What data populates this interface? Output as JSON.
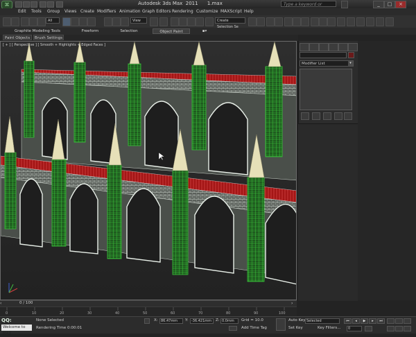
{
  "titlebar": {
    "title": "Autodesk 3ds Max  2011      1.max",
    "search_placeholder": "Type a keyword or phrase",
    "logo_icon": "3dsmax-logo-icon",
    "controls": [
      "_",
      "□",
      "×"
    ]
  },
  "menu": [
    "Edit",
    "Tools",
    "Group",
    "Views",
    "Create",
    "Modifiers",
    "Animation",
    "Graph Editors",
    "Rendering",
    "Customize",
    "MAXScript",
    "Help"
  ],
  "toolbar": {
    "selection_filter": "All",
    "reference_coord": "View",
    "named_selection": "Create Selection Se"
  },
  "ribbon": {
    "tabs": [
      "Graphite Modeling Tools",
      "Freeform",
      "Selection",
      "Object Paint"
    ],
    "active_tab": "Object Paint",
    "sub_tabs": [
      "Paint Objects",
      "Brush Settings"
    ]
  },
  "viewport": {
    "label": "[ + ] [ Perspective ] [ Smooth + Highlights + Edged Faces ]"
  },
  "command_panel": {
    "modifier_list": "Modifier List"
  },
  "timeline": {
    "time_label": "0 / 100",
    "ticks": [
      "0",
      "10",
      "20",
      "30",
      "40",
      "50",
      "60",
      "70",
      "80",
      "90",
      "100"
    ]
  },
  "status": {
    "qq": "QQ:",
    "welcome": "Welcome to MAX",
    "status_line": "None Selected",
    "render_time": "Rendering Time  0:00:01",
    "x_label": "X:",
    "x_value": "86.47mm",
    "y_label": "Y:",
    "y_value": "-36.421mm",
    "z_label": "Z:",
    "z_value": "0.0mm",
    "grid": "Grid = 10.0",
    "add_time_tag": "Add Time Tag",
    "auto_key": "Auto Key",
    "set_key": "Set Key",
    "selected": "Selected",
    "key_filters": "Key Filters...",
    "frame": "0"
  },
  "colors": {
    "wire_green": "#2fa12f",
    "wire_white": "#dfe9df",
    "red_band": "#b01818",
    "spire": "#e6e0b8",
    "viewport_bg": "#2a2a2a"
  }
}
